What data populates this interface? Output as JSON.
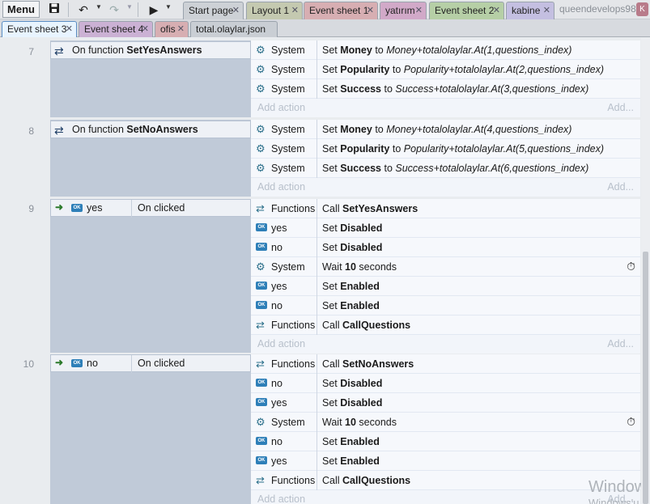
{
  "toolbar": {
    "menu_label": "Menu",
    "save_icon": "floppy-disk",
    "undo_icon": "undo-arrow",
    "redo_icon": "redo-arrow",
    "play_icon": "play-triangle",
    "user_name": "queendevelops98",
    "avatar_letter": "K"
  },
  "tabs_row1": [
    {
      "label": "Start page",
      "color": "#cdd1d6"
    },
    {
      "label": "Layout 1",
      "color": "#c4c9b0"
    },
    {
      "label": "Event sheet 1",
      "color": "#d7aeb2"
    },
    {
      "label": "yatırım",
      "color": "#d1a9c8"
    },
    {
      "label": "Event sheet 2",
      "color": "#b6cfa6"
    },
    {
      "label": "kabine",
      "color": "#c4bfe1"
    }
  ],
  "tabs_row2": [
    {
      "label": "Event sheet 3",
      "color": "#e8f4ff"
    },
    {
      "label": "Event sheet 4",
      "color": "#cbb1d4"
    },
    {
      "label": "ofis",
      "color": "#d7aeb2"
    },
    {
      "label": "total.olaylar.json",
      "color": "#c9ced4"
    }
  ],
  "events": [
    {
      "number": "7",
      "condition": {
        "keyword": "On function",
        "name": "SetYesAnswers"
      },
      "actions": [
        {
          "object": "System",
          "verb": "Set",
          "target": "Money",
          "to": "to",
          "expr": "Money+totalolaylar.At(1,questions_index)"
        },
        {
          "object": "System",
          "verb": "Set",
          "target": "Popularity",
          "to": "to",
          "expr": "Popularity+totalolaylar.At(2,questions_index)"
        },
        {
          "object": "System",
          "verb": "Set",
          "target": "Success",
          "to": "to",
          "expr": "Success+totalolaylar.At(3,questions_index)"
        }
      ]
    },
    {
      "number": "8",
      "condition": {
        "keyword": "On function",
        "name": "SetNoAnswers"
      },
      "actions": [
        {
          "object": "System",
          "verb": "Set",
          "target": "Money",
          "to": "to",
          "expr": "Money+totalolaylar.At(4,questions_index)"
        },
        {
          "object": "System",
          "verb": "Set",
          "target": "Popularity",
          "to": "to",
          "expr": "Popularity+totalolaylar.At(5,questions_index)"
        },
        {
          "object": "System",
          "verb": "Set",
          "target": "Success",
          "to": "to",
          "expr": "Success+totalolaylar.At(6,questions_index)"
        }
      ]
    },
    {
      "number": "9",
      "condition": {
        "object": "yes",
        "trigger": "On clicked"
      },
      "actions": [
        {
          "object": "Functions",
          "verb": "Call",
          "target": "SetYesAnswers"
        },
        {
          "object": "yes",
          "verb": "Set",
          "target": "Disabled"
        },
        {
          "object": "no",
          "verb": "Set",
          "target": "Disabled"
        },
        {
          "object": "System",
          "verb": "Wait",
          "target": "10",
          "suffix": "seconds"
        },
        {
          "object": "yes",
          "verb": "Set",
          "target": "Enabled"
        },
        {
          "object": "no",
          "verb": "Set",
          "target": "Enabled"
        },
        {
          "object": "Functions",
          "verb": "Call",
          "target": "CallQuestions"
        }
      ]
    },
    {
      "number": "10",
      "condition": {
        "object": "no",
        "trigger": "On clicked"
      },
      "actions": [
        {
          "object": "Functions",
          "verb": "Call",
          "target": "SetNoAnswers"
        },
        {
          "object": "no",
          "verb": "Set",
          "target": "Disabled"
        },
        {
          "object": "yes",
          "verb": "Set",
          "target": "Disabled"
        },
        {
          "object": "System",
          "verb": "Wait",
          "target": "10",
          "suffix": "seconds"
        },
        {
          "object": "no",
          "verb": "Set",
          "target": "Enabled"
        },
        {
          "object": "yes",
          "verb": "Set",
          "target": "Enabled"
        },
        {
          "object": "Functions",
          "verb": "Call",
          "target": "CallQuestions"
        }
      ]
    }
  ],
  "add_action_label": "Add action",
  "add_more_label": "Add...",
  "ok_badge": "OK",
  "watermark": {
    "line1": "Windows",
    "line2": "Windows'u"
  }
}
